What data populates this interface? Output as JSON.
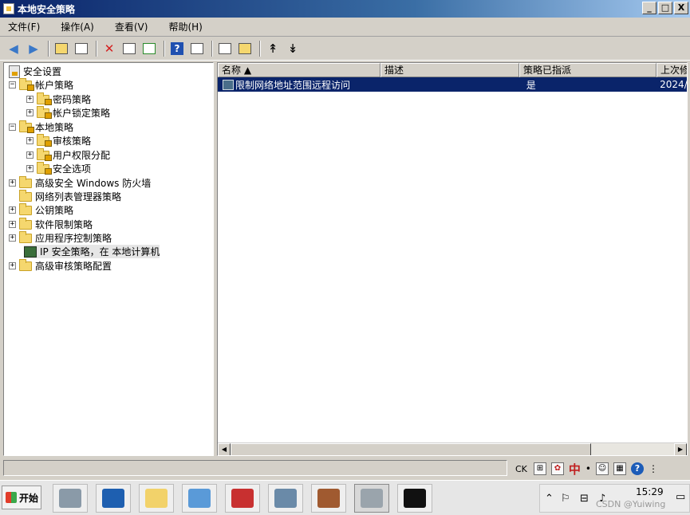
{
  "window": {
    "title": "本地安全策略",
    "controls": {
      "minimize": "_",
      "maximize": "□",
      "close": "X"
    }
  },
  "menu": [
    "文件(F)",
    "操作(A)",
    "查看(V)",
    "帮助(H)"
  ],
  "tree": {
    "root": "安全设置",
    "items": [
      {
        "label": "帐户策略",
        "expander": "−"
      },
      {
        "label": "密码策略",
        "expander": "+"
      },
      {
        "label": "帐户锁定策略",
        "expander": "+"
      },
      {
        "label": "本地策略",
        "expander": "−"
      },
      {
        "label": "审核策略",
        "expander": "+"
      },
      {
        "label": "用户权限分配",
        "expander": "+"
      },
      {
        "label": "安全选项",
        "expander": "+"
      },
      {
        "label": "高级安全 Windows 防火墙",
        "expander": "+"
      },
      {
        "label": "网络列表管理器策略",
        "expander": ""
      },
      {
        "label": "公钥策略",
        "expander": "+"
      },
      {
        "label": "软件限制策略",
        "expander": "+"
      },
      {
        "label": "应用程序控制策略",
        "expander": "+"
      },
      {
        "label": "IP 安全策略，在 本地计算机",
        "expander": ""
      },
      {
        "label": "高级审核策略配置",
        "expander": "+"
      }
    ]
  },
  "list": {
    "columns": [
      "名称 ▲",
      "描述",
      "策略已指派",
      "上次修"
    ],
    "rows": [
      {
        "name": "限制网络地址范围远程访问",
        "description": "",
        "assigned": "是",
        "modified": "2024/"
      }
    ]
  },
  "statusbar": {
    "lang": {
      "ck": "CK",
      "zh": "中",
      "dot": "•"
    },
    "help": "?"
  },
  "taskbar": {
    "start_label": "开始",
    "time": "15:29",
    "watermark": "CSDN @Yuiwing"
  },
  "colors": {
    "title_start": "#0a246a",
    "title_end": "#a6caf0",
    "selection": "#0a246a"
  }
}
